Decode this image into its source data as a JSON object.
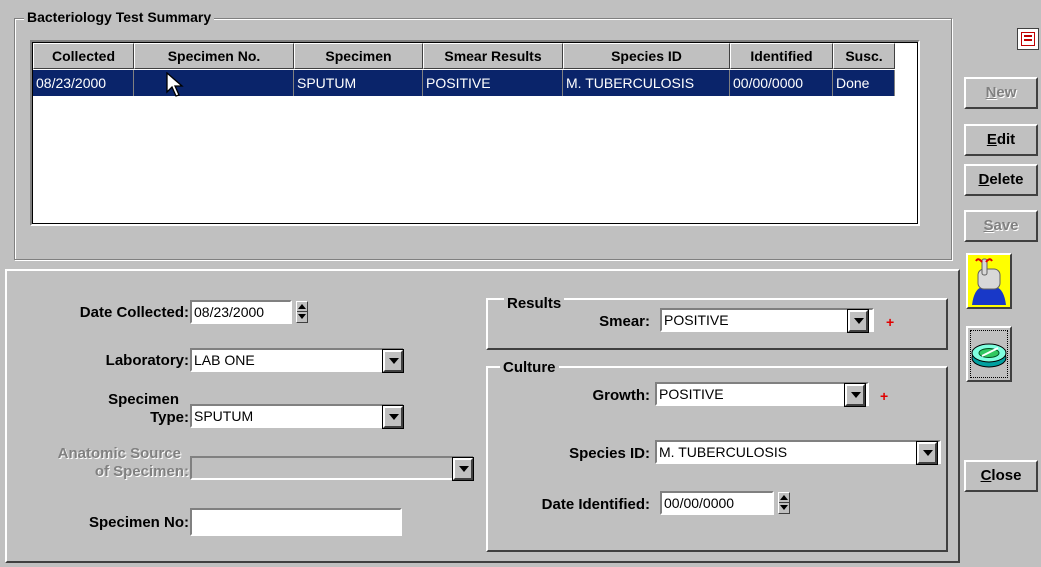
{
  "summary": {
    "title": "Bacteriology Test Summary",
    "columns": [
      "Collected",
      "Specimen No.",
      "Specimen",
      "Smear Results",
      "Species ID",
      "Identified",
      "Susc."
    ],
    "rows": [
      {
        "collected": "08/23/2000",
        "specimen_no": "",
        "specimen": "SPUTUM",
        "smear": "POSITIVE",
        "species": "M. TUBERCULOSIS",
        "identified": "00/00/0000",
        "susc": "Done"
      }
    ]
  },
  "buttons": {
    "new": {
      "key": "N",
      "rest": "ew"
    },
    "edit": {
      "key": "E",
      "rest": "dit"
    },
    "delete": {
      "key": "D",
      "rest": "elete"
    },
    "save": {
      "key": "S",
      "rest": "ave"
    },
    "close": {
      "key": "C",
      "rest": "lose"
    }
  },
  "form": {
    "date_collected_label": "Date Collected:",
    "date_collected": "08/23/2000",
    "laboratory_label": "Laboratory:",
    "laboratory": "LAB ONE",
    "specimen_type_label_1": "Specimen",
    "specimen_type_label_2": "Type:",
    "specimen_type": "SPUTUM",
    "anatomic_label_1": "Anatomic Source",
    "anatomic_label_2": "of Specimen:",
    "anatomic": "",
    "specimen_no_label": "Specimen No:",
    "specimen_no": ""
  },
  "results": {
    "title": "Results",
    "smear_label": "Smear:",
    "smear": "POSITIVE"
  },
  "culture": {
    "title": "Culture",
    "growth_label": "Growth:",
    "growth": "POSITIVE",
    "species_label": "Species ID:",
    "species": "M. TUBERCULOSIS",
    "date_identified_label": "Date Identified:",
    "date_identified": "00/00/0000"
  },
  "required_marker": "+",
  "icons": [
    "hand-reminder-icon",
    "petri-dish-icon",
    "report-icon",
    "mouse-pointer-icon"
  ]
}
